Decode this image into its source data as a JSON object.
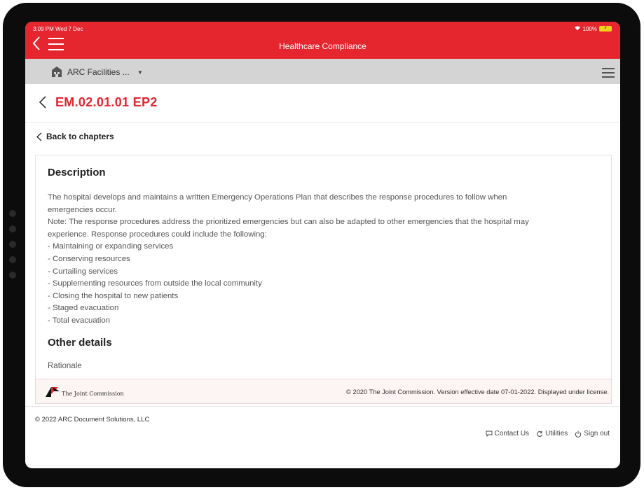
{
  "status": {
    "time": "3:09 PM  Wed 7 Dec",
    "battery": "100%"
  },
  "app": {
    "title": "Healthcare Compliance"
  },
  "facility": {
    "name": "ARC Facilities ..."
  },
  "page": {
    "title": "EM.02.01.01 EP2",
    "back_label": "Back to chapters"
  },
  "description": {
    "heading": "Description",
    "lines": [
      "The hospital develops and maintains a written Emergency Operations Plan that describes the response procedures to follow when",
      "emergencies occur.",
      "Note: The response procedures address the prioritized emergencies but can also be adapted to other emergencies that the hospital may",
      "experience. Response procedures could include the following:",
      "- Maintaining or expanding services",
      "- Conserving resources",
      "- Curtailing services",
      "- Supplementing resources from outside the local community",
      "- Closing the hospital to new patients",
      "- Staged evacuation",
      "- Total evacuation"
    ]
  },
  "other_details": {
    "heading": "Other details",
    "rationale_label": "Rationale"
  },
  "license": {
    "logo_text": "The Joint Commission",
    "text": "© 2020 The Joint Commission. Version effective date 07-01-2022. Displayed under license."
  },
  "footer": {
    "copyright": "© 2022 ARC Document Solutions, LLC",
    "links": [
      "Contact Us",
      "Utilities",
      "Sign out"
    ]
  },
  "colors": {
    "brand": "#e5262e",
    "facility_bar": "#d4d4d4"
  }
}
